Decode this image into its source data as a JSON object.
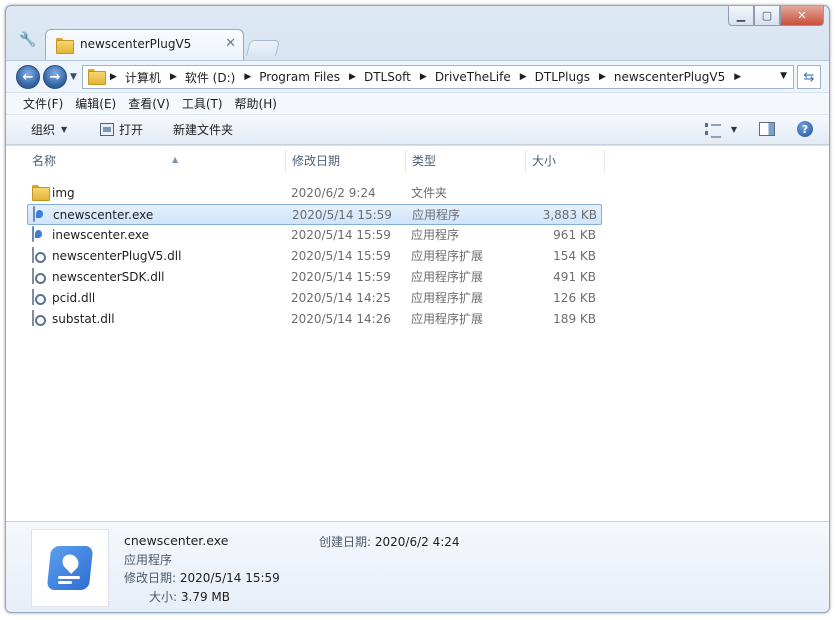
{
  "window": {
    "tab_title": "newscenterPlugV5",
    "caption_buttons": [
      "minimize",
      "maximize",
      "close"
    ]
  },
  "address": {
    "crumbs": [
      "计算机",
      "软件 (D:)",
      "Program Files",
      "DTLSoft",
      "DriveTheLife",
      "DTLPlugs",
      "newscenterPlugV5"
    ]
  },
  "menu": [
    "文件(F)",
    "编辑(E)",
    "查看(V)",
    "工具(T)",
    "帮助(H)"
  ],
  "toolbar": {
    "organize_label": "组织",
    "open_label": "打开",
    "new_folder_label": "新建文件夹"
  },
  "columns": {
    "name": "名称",
    "date": "修改日期",
    "type": "类型",
    "size": "大小"
  },
  "files": [
    {
      "name": "img",
      "date": "2020/6/2 9:24",
      "type": "文件夹",
      "size": "",
      "icon": "folder-icon"
    },
    {
      "name": "cnewscenter.exe",
      "date": "2020/5/14 15:59",
      "type": "应用程序",
      "size": "3,883 KB",
      "icon": "app-icon",
      "selected": true
    },
    {
      "name": "inewscenter.exe",
      "date": "2020/5/14 15:59",
      "type": "应用程序",
      "size": "961 KB",
      "icon": "app-icon"
    },
    {
      "name": "newscenterPlugV5.dll",
      "date": "2020/5/14 15:59",
      "type": "应用程序扩展",
      "size": "154 KB",
      "icon": "dll-icon"
    },
    {
      "name": "newscenterSDK.dll",
      "date": "2020/5/14 15:59",
      "type": "应用程序扩展",
      "size": "491 KB",
      "icon": "dll-icon"
    },
    {
      "name": "pcid.dll",
      "date": "2020/5/14 14:25",
      "type": "应用程序扩展",
      "size": "126 KB",
      "icon": "dll-icon"
    },
    {
      "name": "substat.dll",
      "date": "2020/5/14 14:26",
      "type": "应用程序扩展",
      "size": "189 KB",
      "icon": "dll-icon"
    }
  ],
  "details": {
    "name": "cnewscenter.exe",
    "type": "应用程序",
    "modified_label": "修改日期:",
    "modified_value": "2020/5/14 15:59",
    "size_label": "大小:",
    "size_value": "3.79 MB",
    "created_label": "创建日期:",
    "created_value": "2020/6/2 4:24"
  },
  "colors": {
    "selection_bg": "#cfe4fb",
    "selection_border": "#84acdd",
    "app_icon_blue": "#2f6fd0"
  }
}
